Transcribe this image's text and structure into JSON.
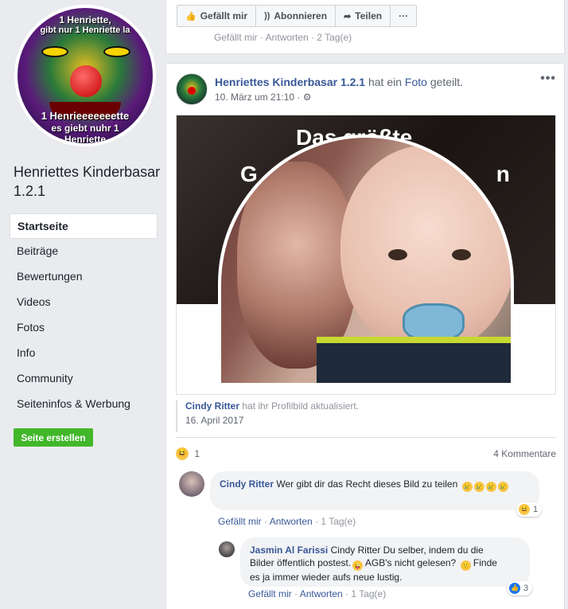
{
  "sidebar": {
    "avatar_overlay": [
      "1 Henriette,",
      "gibt nur 1 Henriette la",
      "1 Henrieeeeeeette",
      "es giebt nuhr 1",
      "Henriette"
    ],
    "page_name": "Henriettes Kinderbasar 1.2.1",
    "nav": [
      {
        "label": "Startseite",
        "active": true
      },
      {
        "label": "Beiträge"
      },
      {
        "label": "Bewertungen"
      },
      {
        "label": "Videos"
      },
      {
        "label": "Fotos"
      },
      {
        "label": "Info"
      },
      {
        "label": "Community"
      },
      {
        "label": "Seiteninfos & Werbung"
      }
    ],
    "create_button": "Seite erstellen"
  },
  "top_card": {
    "like": "Gefällt mir",
    "follow": "Abonnieren",
    "share": "Teilen",
    "more": "···",
    "cut_text": "Gefällt mir · Antworten · 2 Tag(e)"
  },
  "post": {
    "author": "Henriettes Kinderbasar 1.2.1",
    "action_prefix": "hat ein",
    "action_link": "Foto",
    "action_suffix": "geteilt.",
    "date": "10. März um 21:10 ·",
    "privacy_icon": "gear-icon",
    "more": "•••",
    "cover_text_1": "Das größte",
    "cover_text_2": "G",
    "cover_text_3": "n",
    "shared_user": "Cindy Ritter",
    "shared_action": "hat ihr Profilbild aktualisiert.",
    "shared_date": "16. April 2017",
    "reaction_count": "1",
    "comments_count": "4 Kommentare"
  },
  "comments": [
    {
      "name": "Cindy Ritter",
      "text": "Wer gibt dir das Recht dieses Bild zu teilen",
      "reaction": "1",
      "actions": {
        "like": "Gefällt mir",
        "reply": "Antworten",
        "time": "1 Tag(e)"
      }
    },
    {
      "name": "Jasmin Al Farissi",
      "text_1": "Cindy Ritter Du selber, indem du die",
      "text_2": "Bilder öffentlich postest.",
      "text_2b": "AGB's nicht gelesen?",
      "text_3": "Finde",
      "text_4": "es ja immer wieder aufs neue lustig.",
      "reaction": "3",
      "actions": {
        "like": "Gefällt mir",
        "reply": "Antworten",
        "time": "1 Tag(e)"
      }
    }
  ],
  "colors": {
    "accent": "#385898",
    "green": "#42b72a",
    "bg": "#e9ebee"
  }
}
